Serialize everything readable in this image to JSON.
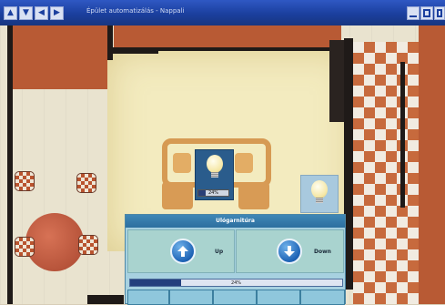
{
  "window": {
    "title": "Épület automatizálás - Nappali",
    "nav_icons": [
      "up-arrow-icon",
      "down-arrow-icon",
      "back-arrow-icon",
      "forward-arrow-icon"
    ],
    "window_buttons": [
      "minimize-icon",
      "maximize-icon",
      "close-icon"
    ]
  },
  "lamps": [
    {
      "name": "living-room-lamp",
      "level_percent": 24,
      "level_label": "24%"
    },
    {
      "name": "corner-lamp"
    }
  ],
  "panel": {
    "title": "Ulógarnitúra",
    "up_label": "Up",
    "down_label": "Down",
    "progress_percent": 24,
    "progress_label": "24%"
  },
  "colors": {
    "titlebar": "#1b3f9e",
    "panel_header": "#2d6f9f",
    "panel_body": "#a7d1e0",
    "progress_fill": "#243f7d"
  }
}
